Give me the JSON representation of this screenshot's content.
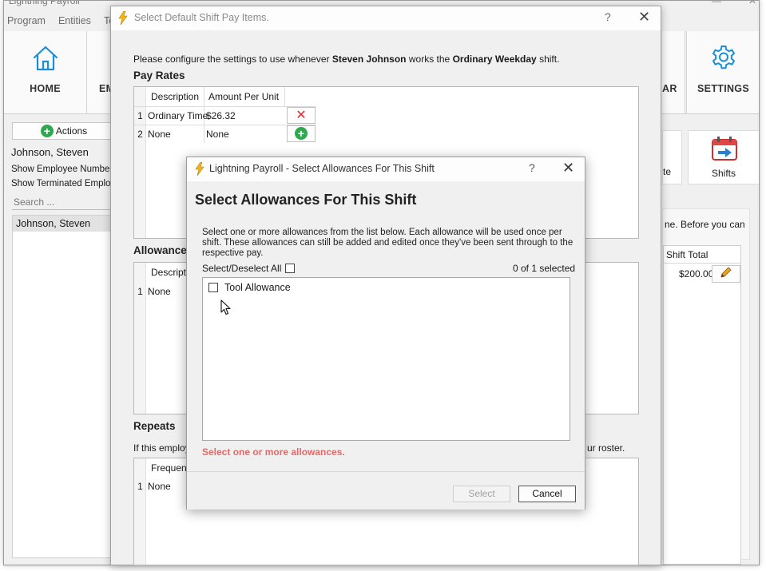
{
  "app": {
    "title": "Lightning Payroll",
    "menu": [
      "Program",
      "Entities",
      "To"
    ],
    "ribbon": {
      "home_label": "HOME",
      "emp_label": "EM",
      "cal_label": "AR",
      "settings_label": "SETTINGS"
    }
  },
  "left_panel": {
    "actions_label": "Actions",
    "employee_name": "Johnson, Steven",
    "show_numbers": "Show Employee Numbers?",
    "show_terminated": "Show Terminated Employe",
    "search_placeholder": "Search ...",
    "list": [
      "Johnson, Steven"
    ]
  },
  "right_panel": {
    "tile_left_label": "te",
    "tile_shifts_label": "Shifts",
    "notice_fragment": "ne. Before you can",
    "col_header": "Shift Total",
    "row_value": "$200.00"
  },
  "shift_dialog": {
    "title": "Select Default Shift Pay Items.",
    "help": "?",
    "intro_prefix": "Please configure the settings to use whenever",
    "intro_employee": "Steven Johnson",
    "intro_middle": "works the",
    "intro_shift": "Ordinary Weekday",
    "intro_suffix": "shift.",
    "pay_rates": {
      "heading": "Pay Rates",
      "columns": [
        "Description",
        "Amount Per Unit"
      ],
      "rows": [
        {
          "num": "1",
          "description": "Ordinary Time",
          "amount": "$26.32"
        },
        {
          "num": "2",
          "description": "None",
          "amount": "None"
        }
      ]
    },
    "allowances": {
      "heading": "Allowance",
      "column": "Descript",
      "rows": [
        {
          "num": "1",
          "description": "None"
        }
      ]
    },
    "repeats": {
      "heading": "Repeats",
      "desc_start": "If this employe",
      "desc_end": "ur roster.",
      "column": "Frequenc",
      "rows": [
        {
          "num": "1",
          "value": "None"
        }
      ]
    }
  },
  "allowance_dialog": {
    "title": "Lightning Payroll - Select Allowances For This Shift",
    "help": "?",
    "heading": "Select Allowances For This Shift",
    "description": "Select one or more allowances from the list below. Each allowance will be used once per shift. These allowances can still be added and edited once they've been sent through to the respective pay.",
    "select_all_label": "Select/Deselect All",
    "count_label": "0 of 1 selected",
    "items": [
      {
        "label": "Tool Allowance",
        "checked": false
      }
    ],
    "error": "Select one or more allowances.",
    "select_button": "Select",
    "cancel_button": "Cancel"
  },
  "colors": {
    "accent_blue": "#1a8fd6",
    "error_red": "#e26a6a",
    "delete_red": "#e12b2b",
    "add_green": "#2fa84f",
    "bolt_yellow": "#f2b616"
  }
}
